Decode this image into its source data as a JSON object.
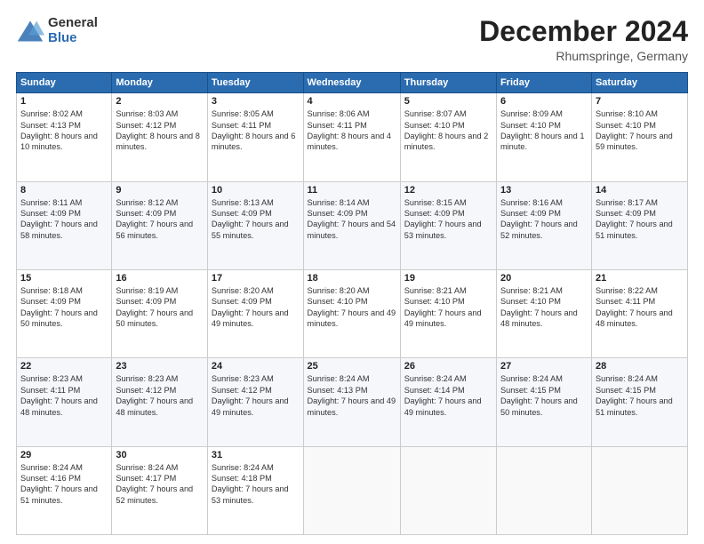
{
  "header": {
    "logo_general": "General",
    "logo_blue": "Blue",
    "month": "December 2024",
    "location": "Rhumspringe, Germany"
  },
  "weekdays": [
    "Sunday",
    "Monday",
    "Tuesday",
    "Wednesday",
    "Thursday",
    "Friday",
    "Saturday"
  ],
  "weeks": [
    [
      {
        "day": "1",
        "sunrise": "8:02 AM",
        "sunset": "4:13 PM",
        "daylight": "8 hours and 10 minutes."
      },
      {
        "day": "2",
        "sunrise": "8:03 AM",
        "sunset": "4:12 PM",
        "daylight": "8 hours and 8 minutes."
      },
      {
        "day": "3",
        "sunrise": "8:05 AM",
        "sunset": "4:11 PM",
        "daylight": "8 hours and 6 minutes."
      },
      {
        "day": "4",
        "sunrise": "8:06 AM",
        "sunset": "4:11 PM",
        "daylight": "8 hours and 4 minutes."
      },
      {
        "day": "5",
        "sunrise": "8:07 AM",
        "sunset": "4:10 PM",
        "daylight": "8 hours and 2 minutes."
      },
      {
        "day": "6",
        "sunrise": "8:09 AM",
        "sunset": "4:10 PM",
        "daylight": "8 hours and 1 minute."
      },
      {
        "day": "7",
        "sunrise": "8:10 AM",
        "sunset": "4:10 PM",
        "daylight": "7 hours and 59 minutes."
      }
    ],
    [
      {
        "day": "8",
        "sunrise": "8:11 AM",
        "sunset": "4:09 PM",
        "daylight": "7 hours and 58 minutes."
      },
      {
        "day": "9",
        "sunrise": "8:12 AM",
        "sunset": "4:09 PM",
        "daylight": "7 hours and 56 minutes."
      },
      {
        "day": "10",
        "sunrise": "8:13 AM",
        "sunset": "4:09 PM",
        "daylight": "7 hours and 55 minutes."
      },
      {
        "day": "11",
        "sunrise": "8:14 AM",
        "sunset": "4:09 PM",
        "daylight": "7 hours and 54 minutes."
      },
      {
        "day": "12",
        "sunrise": "8:15 AM",
        "sunset": "4:09 PM",
        "daylight": "7 hours and 53 minutes."
      },
      {
        "day": "13",
        "sunrise": "8:16 AM",
        "sunset": "4:09 PM",
        "daylight": "7 hours and 52 minutes."
      },
      {
        "day": "14",
        "sunrise": "8:17 AM",
        "sunset": "4:09 PM",
        "daylight": "7 hours and 51 minutes."
      }
    ],
    [
      {
        "day": "15",
        "sunrise": "8:18 AM",
        "sunset": "4:09 PM",
        "daylight": "7 hours and 50 minutes."
      },
      {
        "day": "16",
        "sunrise": "8:19 AM",
        "sunset": "4:09 PM",
        "daylight": "7 hours and 50 minutes."
      },
      {
        "day": "17",
        "sunrise": "8:20 AM",
        "sunset": "4:09 PM",
        "daylight": "7 hours and 49 minutes."
      },
      {
        "day": "18",
        "sunrise": "8:20 AM",
        "sunset": "4:10 PM",
        "daylight": "7 hours and 49 minutes."
      },
      {
        "day": "19",
        "sunrise": "8:21 AM",
        "sunset": "4:10 PM",
        "daylight": "7 hours and 49 minutes."
      },
      {
        "day": "20",
        "sunrise": "8:21 AM",
        "sunset": "4:10 PM",
        "daylight": "7 hours and 48 minutes."
      },
      {
        "day": "21",
        "sunrise": "8:22 AM",
        "sunset": "4:11 PM",
        "daylight": "7 hours and 48 minutes."
      }
    ],
    [
      {
        "day": "22",
        "sunrise": "8:23 AM",
        "sunset": "4:11 PM",
        "daylight": "7 hours and 48 minutes."
      },
      {
        "day": "23",
        "sunrise": "8:23 AM",
        "sunset": "4:12 PM",
        "daylight": "7 hours and 48 minutes."
      },
      {
        "day": "24",
        "sunrise": "8:23 AM",
        "sunset": "4:12 PM",
        "daylight": "7 hours and 49 minutes."
      },
      {
        "day": "25",
        "sunrise": "8:24 AM",
        "sunset": "4:13 PM",
        "daylight": "7 hours and 49 minutes."
      },
      {
        "day": "26",
        "sunrise": "8:24 AM",
        "sunset": "4:14 PM",
        "daylight": "7 hours and 49 minutes."
      },
      {
        "day": "27",
        "sunrise": "8:24 AM",
        "sunset": "4:15 PM",
        "daylight": "7 hours and 50 minutes."
      },
      {
        "day": "28",
        "sunrise": "8:24 AM",
        "sunset": "4:15 PM",
        "daylight": "7 hours and 51 minutes."
      }
    ],
    [
      {
        "day": "29",
        "sunrise": "8:24 AM",
        "sunset": "4:16 PM",
        "daylight": "7 hours and 51 minutes."
      },
      {
        "day": "30",
        "sunrise": "8:24 AM",
        "sunset": "4:17 PM",
        "daylight": "7 hours and 52 minutes."
      },
      {
        "day": "31",
        "sunrise": "8:24 AM",
        "sunset": "4:18 PM",
        "daylight": "7 hours and 53 minutes."
      },
      null,
      null,
      null,
      null
    ]
  ]
}
